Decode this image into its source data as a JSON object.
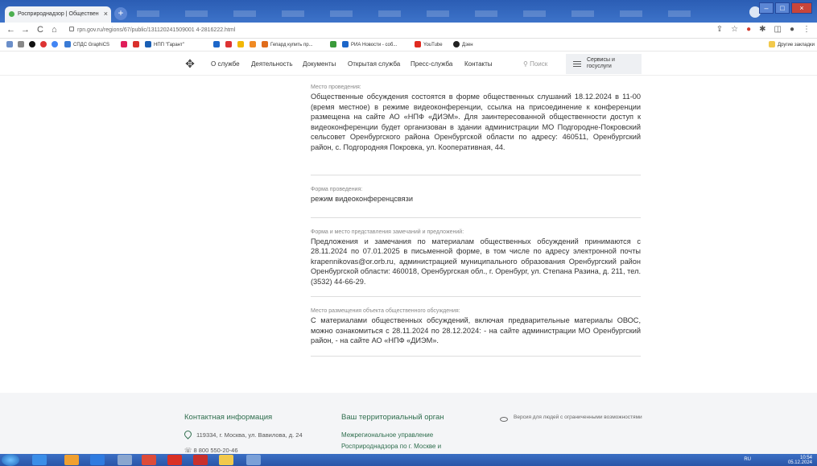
{
  "browser": {
    "tab_title": "Росприроднадзор | Обществен",
    "tab_close": "×",
    "new_tab": "+",
    "url": "rpn.gov.ru/regions/67/public/131120241509001 4-2816222.html",
    "nav": {
      "back": "←",
      "forward": "→",
      "reload": "C",
      "home": "⌂"
    },
    "bookmarks": [
      {
        "label": "СПДС GraphiCS",
        "color": "#3a7bd5"
      },
      {
        "label": "НПП \"Гарант\"",
        "color": "#1a5fb4"
      },
      {
        "label": "Гепард купить пр...",
        "color": "#e06c1b"
      },
      {
        "label": "РИА Новости - coб...",
        "color": "#1c66c9"
      },
      {
        "label": "YouTube",
        "color": "#e02b20"
      },
      {
        "label": "Дзен",
        "color": "#222222"
      }
    ],
    "other_bookmarks": "Другие закладки"
  },
  "site": {
    "menu": [
      "О службе",
      "Деятельность",
      "Документы",
      "Открытая служба",
      "Пресс-служба",
      "Контакты"
    ],
    "search": "Поиск",
    "services_line1": "Сервисы и",
    "services_line2": "госуслуги"
  },
  "sections": [
    {
      "label": "Место проведения:",
      "text": "Общественные обсуждения состоятся в форме общественных слушаний 18.12.2024 в 11-00 (время местное) в режиме видеоконференции, ссылка на присоединение к конференции размещена на сайте АО «НПФ «ДИЭМ». Для заинтересованной общественности доступ к видеоконференции будет организован в здании администрации МО Подгородне-Покровский сельсовет Оренбургского района Оренбургской области по адресу: 460511, Оренбургский район, с. Подгородняя Покровка, ул. Кооперативная, 44."
    },
    {
      "label": "Форма проведения:",
      "text": "режим видеоконференцсвязи"
    },
    {
      "label": "Форма и место представления замечаний и предложений:",
      "text": "Предложения и замечания по материалам общественных обсуждений принимаются с 28.11.2024 по 07.01.2025 в письменной форме, в том числе по адресу электронной почты krapennikovas@or.orb.ru, администрацией муниципального образования Оренбургский район Оренбургской области: 460018, Оренбургская обл., г. Оренбург, ул. Степана Разина, д. 211, тел. (3532) 44-66-29."
    },
    {
      "label": "Место размещения объекта общественного обсуждения:",
      "text": "С материалами общественных обсуждений, включая предварительные материалы ОВОС, можно ознакомиться с 28.11.2024 по 28.12.2024: - на сайте администрации МО Оренбургский район, - на сайте АО «НПФ «ДИЭМ»."
    }
  ],
  "footer": {
    "contact_title": "Контактная информация",
    "address": "119334, г. Москва, ул. Вавилова, д. 24",
    "phone": "8 800 550-20-46",
    "territorial_title": "Ваш территориальный орган",
    "territorial_line1": "Межрегиональное управление",
    "territorial_line2": "Росприроднадзора по г. Москве и",
    "accessibility": "Версия для людей с ограниченными возможностями"
  },
  "taskbar": {
    "lang": "RU",
    "time": "10:54",
    "date": "05.12.2024"
  }
}
